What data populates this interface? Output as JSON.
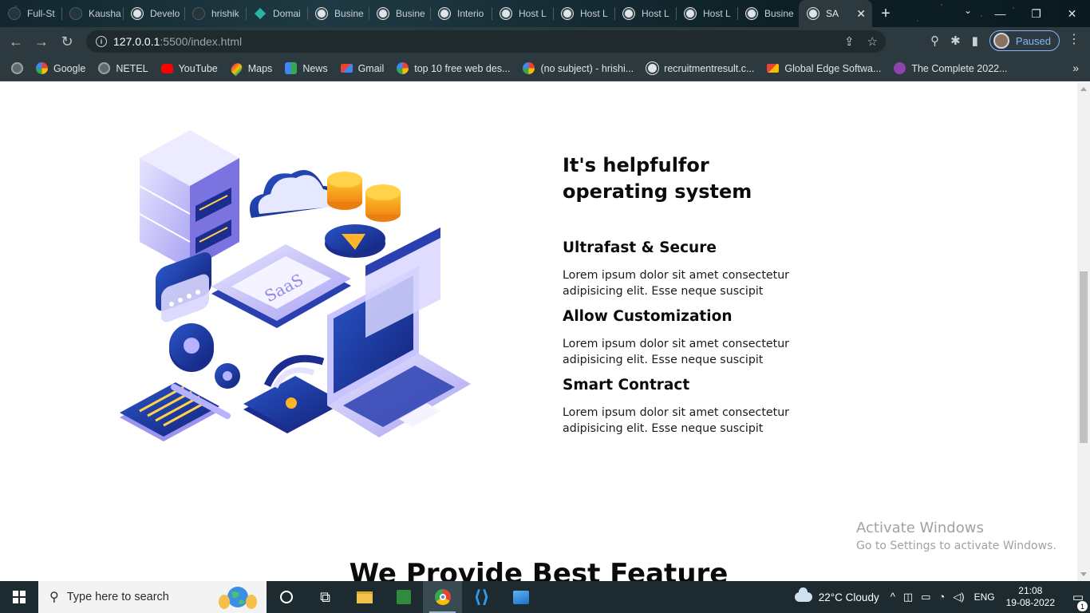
{
  "browser": {
    "tabs": [
      {
        "title": "Full-St",
        "icon": "dark-circle-icon"
      },
      {
        "title": "Kausha",
        "icon": "dark-circle-icon"
      },
      {
        "title": "Develo",
        "icon": "globe-icon"
      },
      {
        "title": "hrishik",
        "icon": "dark-circle-icon"
      },
      {
        "title": "Domai",
        "icon": "diamond-icon"
      },
      {
        "title": "Busine",
        "icon": "globe-icon"
      },
      {
        "title": "Busine",
        "icon": "globe-icon"
      },
      {
        "title": "Interio",
        "icon": "globe-icon"
      },
      {
        "title": "Host L",
        "icon": "globe-icon"
      },
      {
        "title": "Host L",
        "icon": "globe-icon"
      },
      {
        "title": "Host L",
        "icon": "globe-icon"
      },
      {
        "title": "Host L",
        "icon": "globe-icon"
      },
      {
        "title": "Busine",
        "icon": "globe-icon"
      },
      {
        "title": "SA",
        "icon": "globe-icon",
        "active": true
      }
    ],
    "url_host": "127.0.0.1",
    "url_path": ":5500/index.html",
    "profile_status": "Paused",
    "bookmarks": [
      {
        "label": "Google",
        "icon": "google-icon"
      },
      {
        "label": "NETEL",
        "icon": "globe-icon"
      },
      {
        "label": "YouTube",
        "icon": "youtube-icon"
      },
      {
        "label": "Maps",
        "icon": "maps-icon"
      },
      {
        "label": "News",
        "icon": "news-icon"
      },
      {
        "label": "Gmail",
        "icon": "gmail-icon"
      },
      {
        "label": "top 10 free web des...",
        "icon": "google-icon"
      },
      {
        "label": "(no subject) - hrishi...",
        "icon": "google-icon"
      },
      {
        "label": "recruitmentresult.c...",
        "icon": "wordpress-icon"
      },
      {
        "label": "Global Edge Softwa...",
        "icon": "gmail-icon"
      },
      {
        "label": "The Complete 2022...",
        "icon": "udemy-icon"
      }
    ]
  },
  "page": {
    "illustration_label": "SaaS",
    "heading": "It's helpfulfor operating system",
    "features": [
      {
        "title": "Ultrafast & Secure",
        "text": "Lorem ipsum dolor sit amet consectetur adipisicing elit. Esse neque suscipit"
      },
      {
        "title": "Allow Customization",
        "text": "Lorem ipsum dolor sit amet consectetur adipisicing elit. Esse neque suscipit"
      },
      {
        "title": "Smart Contract",
        "text": "Lorem ipsum dolor sit amet consectetur adipisicing elit. Esse neque suscipit"
      }
    ],
    "next_section_heading": "We Provide Best Feature"
  },
  "watermark": {
    "title": "Activate Windows",
    "subtitle": "Go to Settings to activate Windows."
  },
  "taskbar": {
    "search_placeholder": "Type here to search",
    "apps": [
      "task-view-icon",
      "file-explorer-icon",
      "spreadsheet-icon",
      "chrome-icon",
      "vscode-icon",
      "photos-icon"
    ],
    "weather": "22°C  Cloudy",
    "language": "ENG",
    "time": "21:08",
    "date": "19-08-2022",
    "notification_count": "1"
  }
}
